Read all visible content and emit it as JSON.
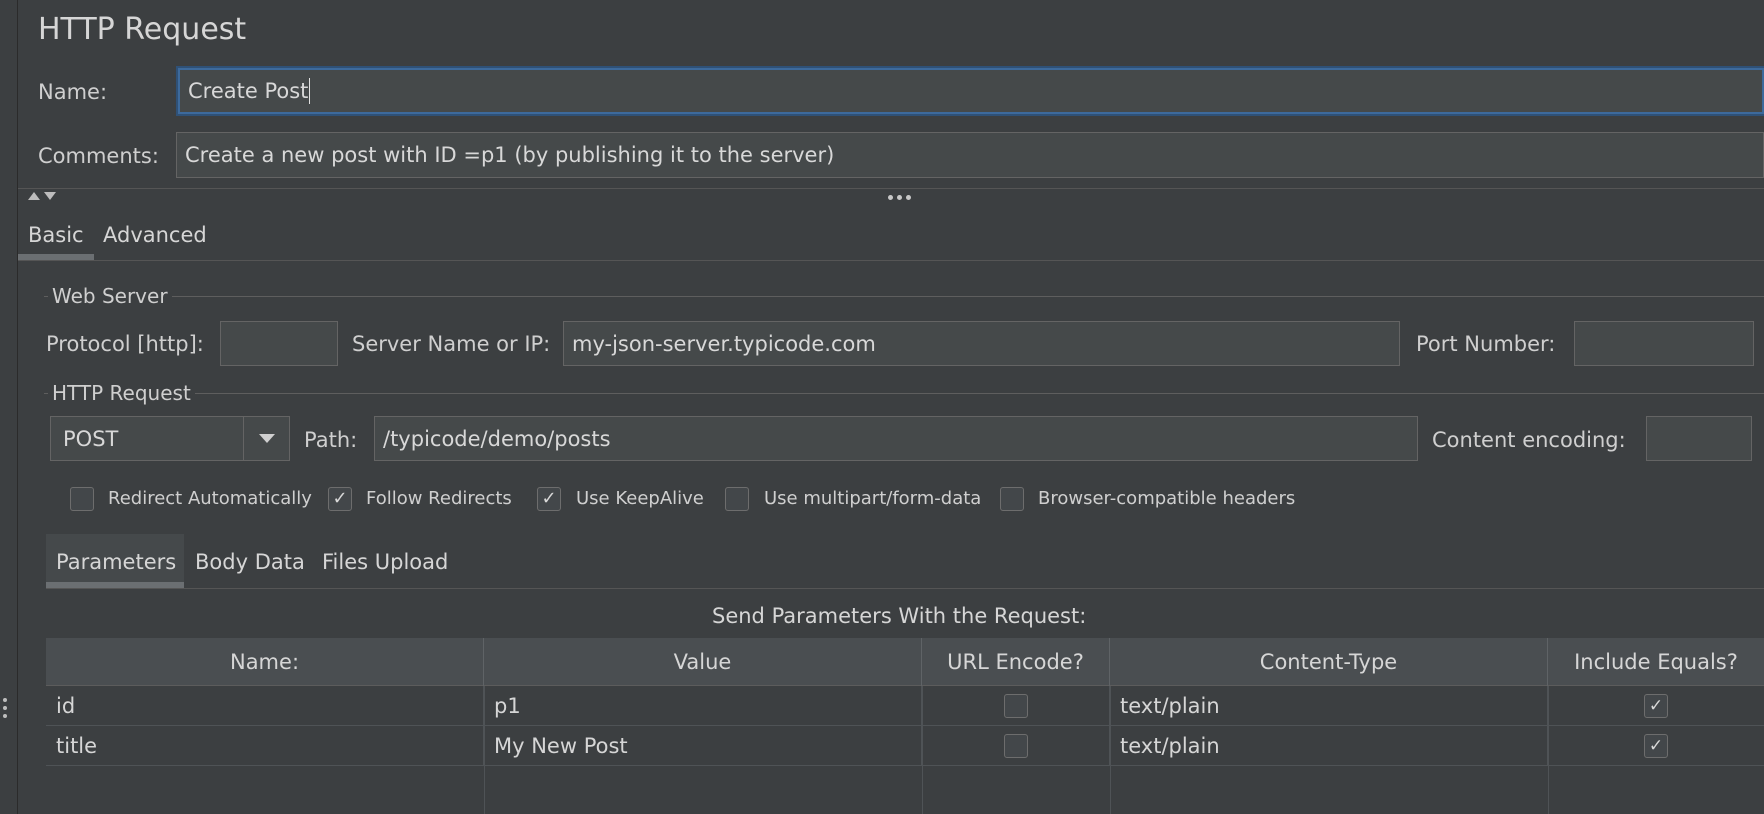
{
  "header": {
    "title": "HTTP Request",
    "name_label": "Name:",
    "name_value": "Create Post",
    "comments_label": "Comments:",
    "comments_value": "Create a new post with ID =p1 (by publishing it to the server)"
  },
  "tabs": [
    {
      "label": "Basic",
      "selected": true
    },
    {
      "label": "Advanced",
      "selected": false
    }
  ],
  "web_server": {
    "group_title": "Web Server",
    "protocol_label": "Protocol [http]:",
    "protocol_value": "",
    "server_label": "Server Name or IP:",
    "server_value": "my-json-server.typicode.com",
    "port_label": "Port Number:",
    "port_value": ""
  },
  "http_request": {
    "group_title": "HTTP Request",
    "method": "POST",
    "path_label": "Path:",
    "path_value": "/typicode/demo/posts",
    "encoding_label": "Content encoding:",
    "encoding_value": ""
  },
  "options": [
    {
      "label": "Redirect Automatically",
      "checked": false
    },
    {
      "label": "Follow Redirects",
      "checked": true
    },
    {
      "label": "Use KeepAlive",
      "checked": true
    },
    {
      "label": "Use multipart/form-data",
      "checked": false
    },
    {
      "label": "Browser-compatible headers",
      "checked": false
    }
  ],
  "sub_tabs": [
    {
      "label": "Parameters",
      "selected": true
    },
    {
      "label": "Body Data",
      "selected": false
    },
    {
      "label": "Files Upload",
      "selected": false
    }
  ],
  "params": {
    "caption": "Send Parameters With the Request:",
    "columns": [
      "Name:",
      "Value",
      "URL Encode?",
      "Content-Type",
      "Include Equals?"
    ],
    "rows": [
      {
        "name": "id",
        "value": "p1",
        "url_encode": false,
        "content_type": "text/plain",
        "include_equals": true
      },
      {
        "name": "title",
        "value": "My New Post",
        "url_encode": false,
        "content_type": "text/plain",
        "include_equals": true
      }
    ]
  },
  "check_mark": "✓"
}
